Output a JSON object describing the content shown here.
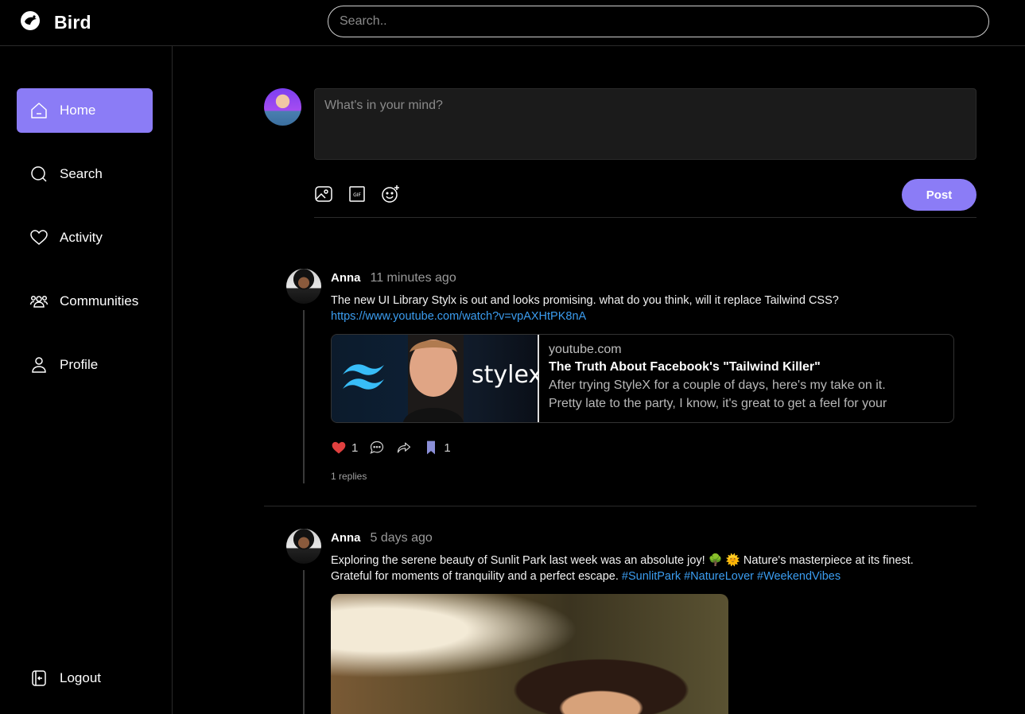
{
  "brand": {
    "name": "Bird",
    "logo_icon": "bird-logo-icon"
  },
  "search": {
    "placeholder": "Search.."
  },
  "sidebar": {
    "items": [
      {
        "label": "Home",
        "icon": "home-icon",
        "active": true
      },
      {
        "label": "Search",
        "icon": "search-icon",
        "active": false
      },
      {
        "label": "Activity",
        "icon": "heart-icon",
        "active": false
      },
      {
        "label": "Communities",
        "icon": "users-icon",
        "active": false
      },
      {
        "label": "Profile",
        "icon": "user-icon",
        "active": false
      }
    ],
    "logout": {
      "label": "Logout",
      "icon": "logout-icon"
    }
  },
  "composer": {
    "placeholder": "What's in your mind?",
    "tools": [
      "image-icon",
      "gif-icon",
      "emoji-icon"
    ],
    "post_label": "Post"
  },
  "posts": [
    {
      "author": "Anna",
      "time": "11 minutes ago",
      "text": "The new UI Library Stylx is out and looks promising. what do you think, will it replace Tailwind CSS?",
      "link": "https://www.youtube.com/watch?v=vpAXHtPK8nA",
      "card": {
        "domain": "youtube.com",
        "title": "The Truth About Facebook's \"Tailwind Killer\"",
        "desc_line1": "After trying StyleX for a couple of days, here's my take on it.",
        "desc_line2": "Pretty late to the party, I know, it's great to get a feel for your",
        "thumb_text": "stylex"
      },
      "likes": "1",
      "bookmarks": "1",
      "replies": "1 replies"
    },
    {
      "author": "Anna",
      "time": "5 days ago",
      "text_line1": "Exploring the serene beauty of Sunlit Park last week was an absolute joy! 🌳 🌞 Nature's masterpiece at its finest.",
      "text_line2": "Grateful for moments of tranquility and a perfect escape.",
      "tags": [
        "#SunlitPark",
        "#NatureLover",
        "#WeekendVibes"
      ]
    }
  ],
  "colors": {
    "accent": "#8b7cf6",
    "link": "#3b9df0",
    "like": "#e0403f",
    "background": "#000000"
  }
}
